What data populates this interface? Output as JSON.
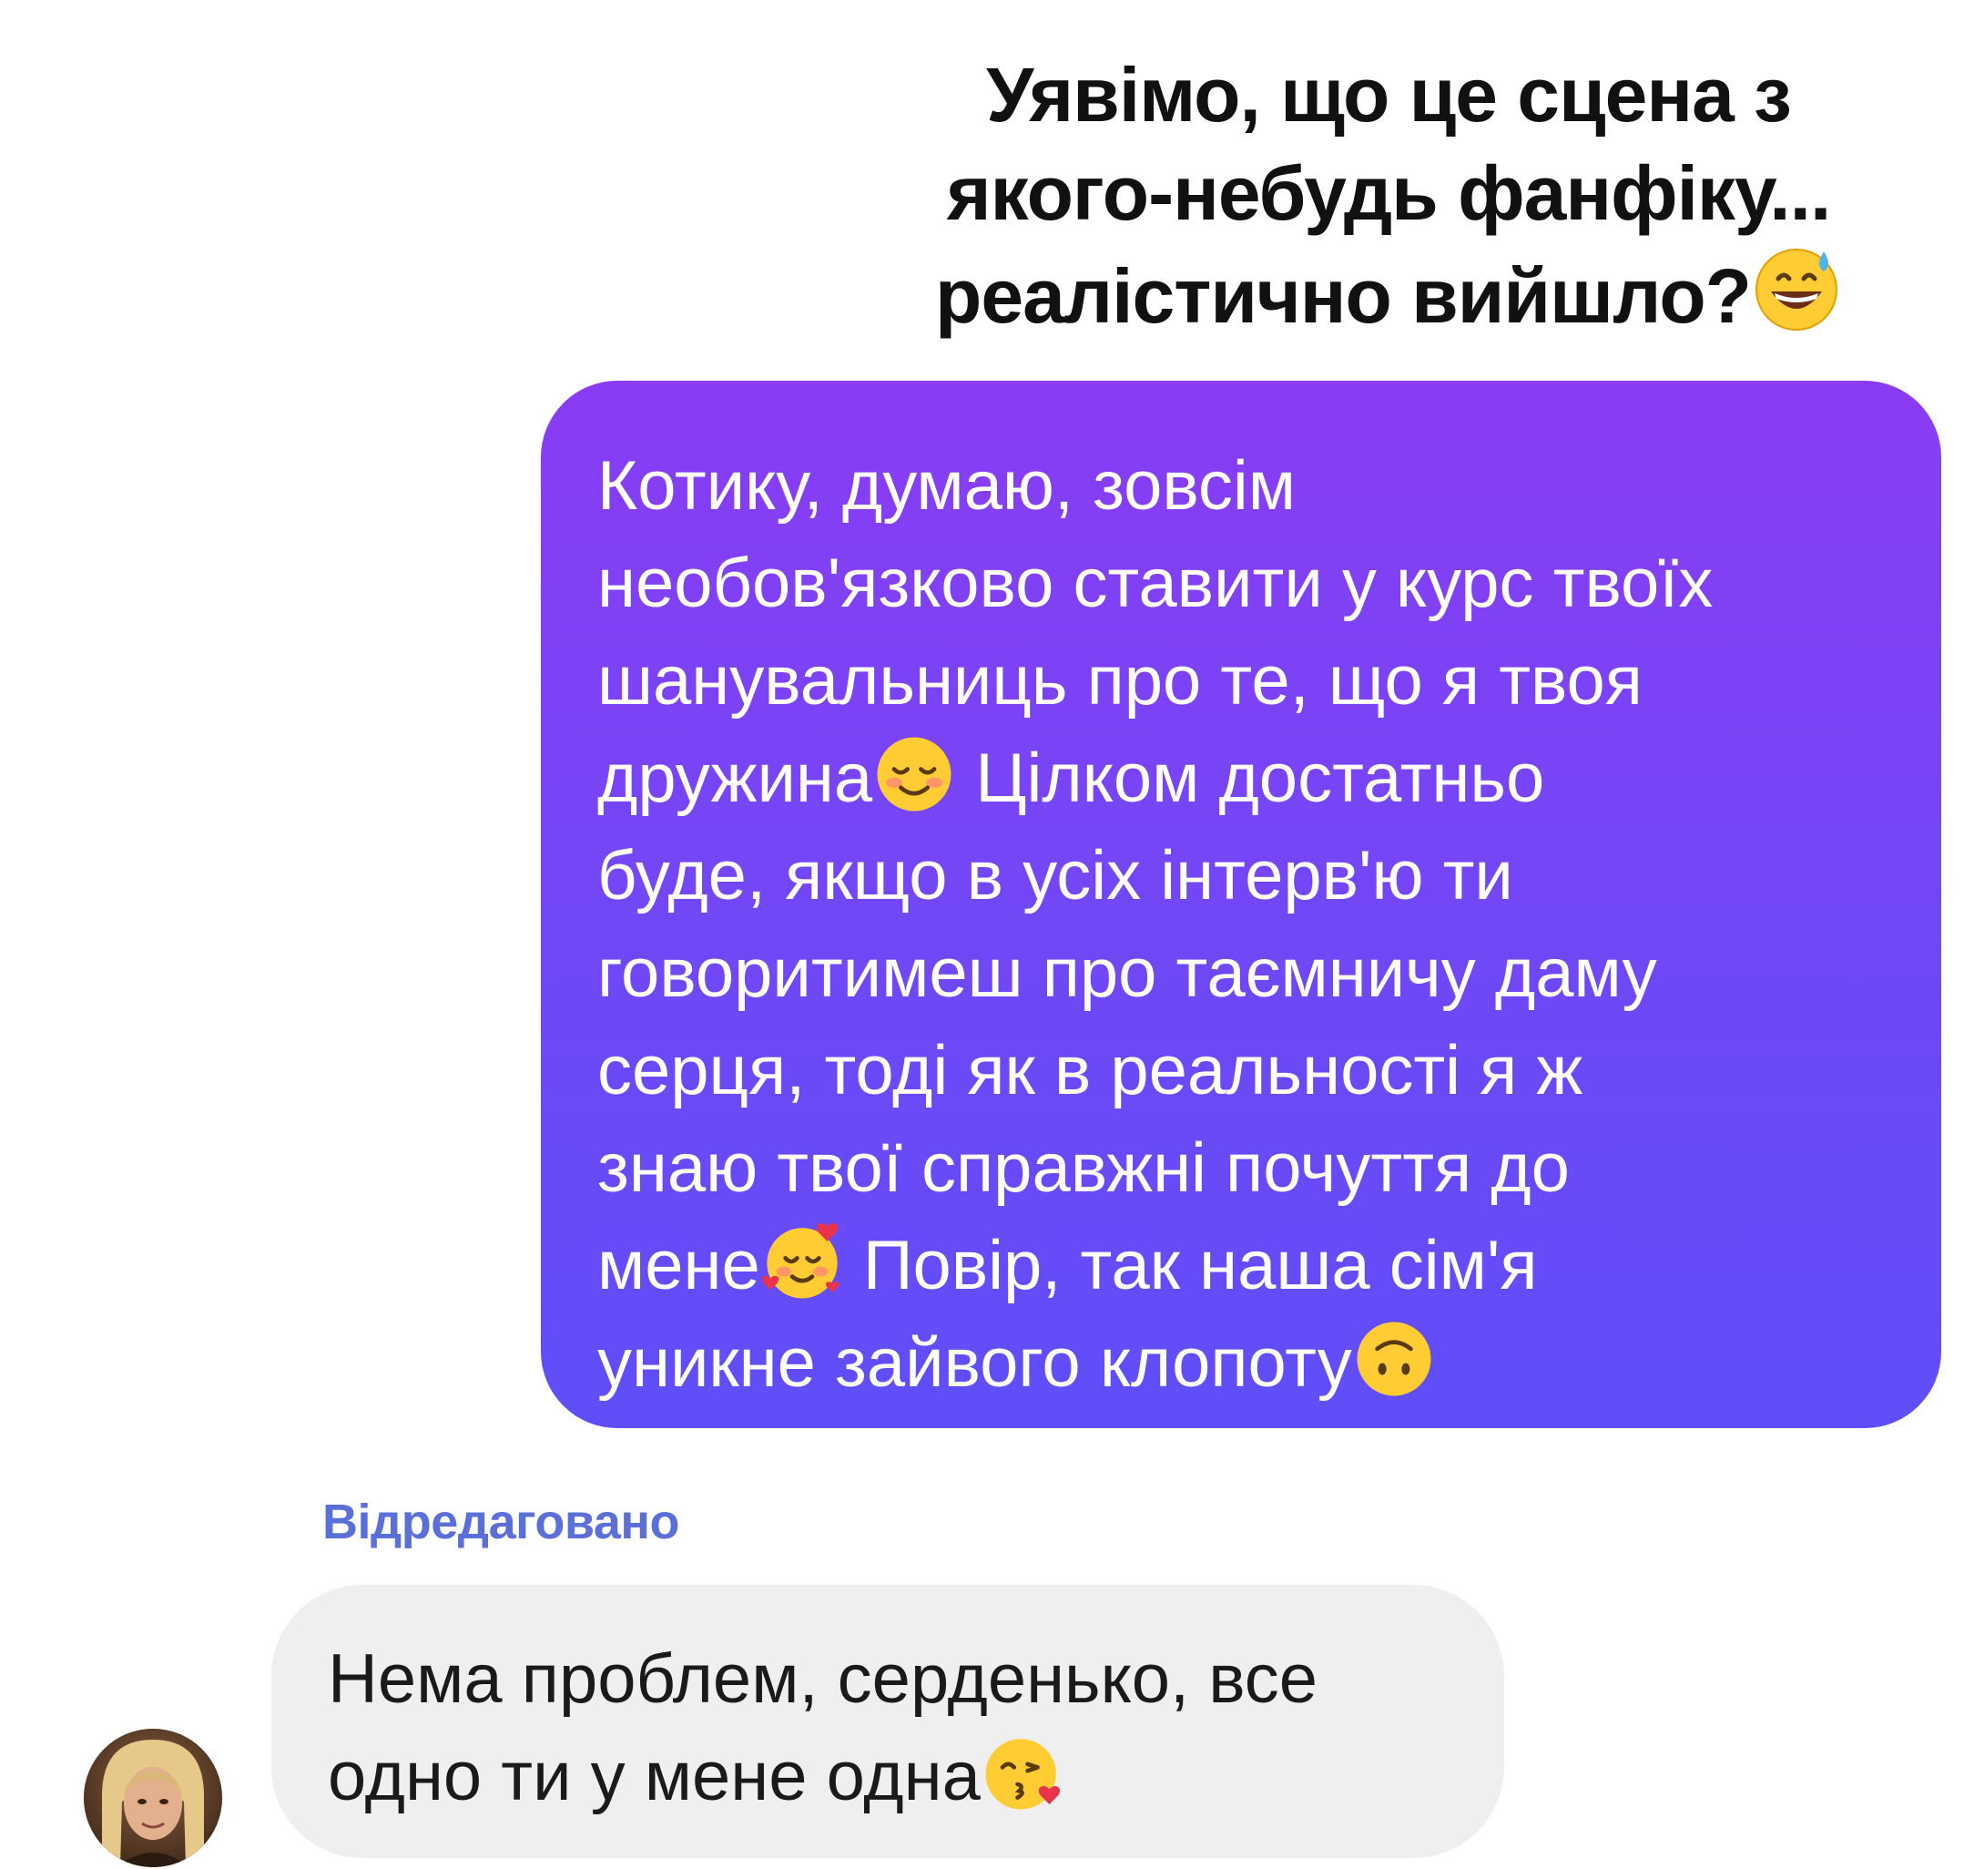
{
  "caption": {
    "lines": [
      "Уявімо, що це сцена з",
      "якого-небудь фанфіку...",
      "реалістично вийшло?"
    ],
    "emoji": "grinning-sweat-emoji"
  },
  "outgoing_message": {
    "lines": [
      "Котику, думаю, зовсім",
      "необов'язково ставити у курс твоїх",
      "шанувальниць про те, що я твоя",
      "дружина",
      " Цілком достатньо",
      "буде, якщо в усіх інтерв'ю ти",
      "говоритимеш про таємничу даму",
      "серця, тоді як в реальності я ж",
      "знаю твої справжні почуття до",
      "мене",
      " Повір, так наша сім'я",
      "уникне зайвого клопоту"
    ],
    "emojis": [
      "smiling-blush-emoji",
      "smiling-hearts-emoji",
      "upside-down-face-emoji"
    ],
    "bubble_color": "#7446f6"
  },
  "edited_label": "Відредаговано",
  "incoming_message": {
    "lines": [
      "Нема проблем, серденько, все",
      "одно ти у мене одна"
    ],
    "emoji": "kissing-heart-emoji",
    "bubble_color": "#efefef"
  },
  "avatar": {
    "icon": "avatar-photo"
  }
}
